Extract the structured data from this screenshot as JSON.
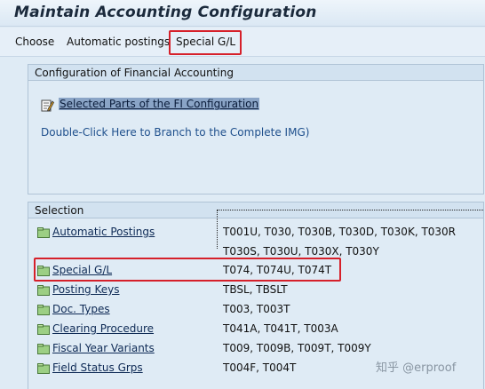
{
  "window": {
    "title": "Maintain Accounting Configuration"
  },
  "menu": {
    "items": [
      "Choose",
      "Automatic postings",
      "Special G/L"
    ]
  },
  "config_group": {
    "header": "Configuration of Financial Accounting",
    "selected_node": "Selected Parts of the FI Configuration",
    "branch_link": "Double-Click Here to Branch to the Complete IMG)"
  },
  "selection_group": {
    "header": "Selection",
    "items": [
      {
        "label": "Automatic Postings",
        "tables": [
          "T001U, T030,  T030B, T030D, T030K, T030R",
          "T030S, T030U, T030X, T030Y"
        ]
      },
      {
        "label": "Special G/L",
        "tables": [
          "T074,  T074U, T074T"
        ]
      },
      {
        "label": "Posting Keys",
        "tables": [
          "TBSL,  TBSLT"
        ]
      },
      {
        "label": "Doc. Types",
        "tables": [
          "T003,  T003T"
        ]
      },
      {
        "label": "Clearing Procedure",
        "tables": [
          "T041A, T041T, T003A"
        ]
      },
      {
        "label": "Fiscal Year Variants",
        "tables": [
          "T009,  T009B, T009T, T009Y"
        ]
      },
      {
        "label": "Field Status Grps",
        "tables": [
          "T004F, T004T"
        ]
      }
    ]
  },
  "colors": {
    "highlight_border": "#d6202a",
    "background": "#dfebf5",
    "link": "#0e2a55"
  },
  "watermark": "知乎 @erproof"
}
